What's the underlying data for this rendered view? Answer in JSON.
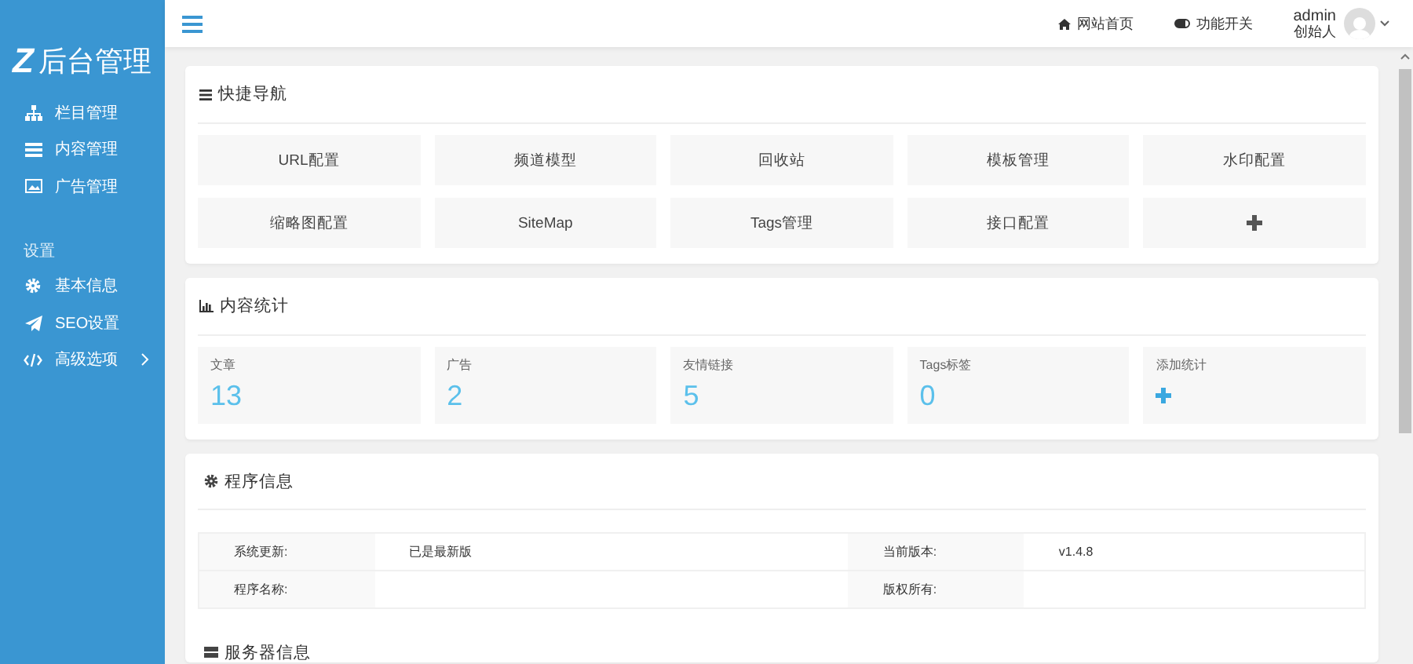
{
  "sidebar": {
    "logo_mark": "Z",
    "logo_text": "后台管理",
    "menu": [
      {
        "kind": "item",
        "label": "栏目管理",
        "has_submenu": false
      },
      {
        "kind": "item",
        "label": "内容管理",
        "has_submenu": false
      },
      {
        "kind": "item",
        "label": "广告管理",
        "has_submenu": false
      },
      {
        "kind": "heading",
        "label": "设置"
      },
      {
        "kind": "item",
        "label": "基本信息",
        "has_submenu": false
      },
      {
        "kind": "item",
        "label": "SEO设置",
        "has_submenu": false
      },
      {
        "kind": "item",
        "label": "高级选项",
        "has_submenu": true
      }
    ]
  },
  "topbar": {
    "links": [
      {
        "label": "网站首页"
      },
      {
        "label": "功能开关"
      }
    ],
    "user": {
      "name": "admin",
      "role": "创始人"
    }
  },
  "quick_nav": {
    "title": "快捷导航",
    "items": [
      {
        "kind": "link",
        "label": "URL配置"
      },
      {
        "kind": "link",
        "label": "频道模型"
      },
      {
        "kind": "link",
        "label": "回收站"
      },
      {
        "kind": "link",
        "label": "模板管理"
      },
      {
        "kind": "link",
        "label": "水印配置"
      },
      {
        "kind": "link",
        "label": "缩略图配置"
      },
      {
        "kind": "link",
        "label": "SiteMap"
      },
      {
        "kind": "link",
        "label": "Tags管理"
      },
      {
        "kind": "link",
        "label": "接口配置"
      },
      {
        "kind": "add"
      }
    ]
  },
  "stats": {
    "title": "内容统计",
    "items": [
      {
        "kind": "count",
        "label": "文章",
        "value": "13"
      },
      {
        "kind": "count",
        "label": "广告",
        "value": "2"
      },
      {
        "kind": "count",
        "label": "友情链接",
        "value": "5"
      },
      {
        "kind": "count",
        "label": "Tags标签",
        "value": "0"
      },
      {
        "kind": "add",
        "label": "添加统计"
      }
    ]
  },
  "program_info": {
    "title": "程序信息",
    "rows": [
      {
        "cells": [
          {
            "label": "系统更新:",
            "value": "已是最新版"
          },
          {
            "label": "当前版本:",
            "value": "v1.4.8"
          }
        ]
      },
      {
        "cells": [
          {
            "label": "程序名称:"
          },
          {
            "label": "版权所有:"
          }
        ]
      }
    ]
  },
  "server_info": {
    "title": "服务器信息"
  }
}
